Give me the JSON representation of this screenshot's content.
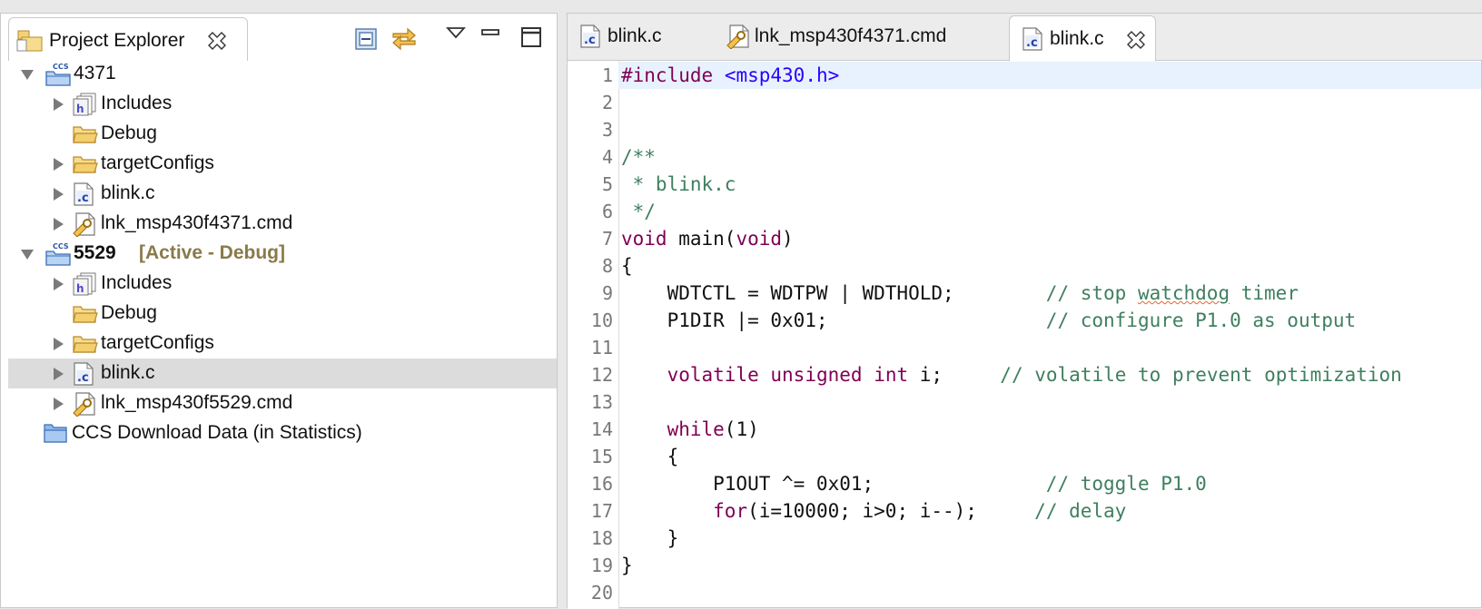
{
  "explorer": {
    "title": "Project Explorer",
    "tree": [
      {
        "label": "4371",
        "bold": false,
        "twisty": "open",
        "indent": 0,
        "icon": "ccs-project-icon"
      },
      {
        "label": "Includes",
        "twisty": "closed",
        "indent": 1,
        "icon": "includes-icon"
      },
      {
        "label": "Debug",
        "twisty": "none",
        "indent": 1,
        "icon": "folder-icon"
      },
      {
        "label": "targetConfigs",
        "twisty": "closed",
        "indent": 1,
        "icon": "folder-icon"
      },
      {
        "label": "blink.c",
        "twisty": "closed",
        "indent": 1,
        "icon": "c-file-icon"
      },
      {
        "label": "lnk_msp430f4371.cmd",
        "twisty": "closed",
        "indent": 1,
        "icon": "cmd-file-icon"
      },
      {
        "label": "5529",
        "bold": true,
        "decoration": "[Active - Debug]",
        "twisty": "open",
        "indent": 0,
        "icon": "ccs-project-icon"
      },
      {
        "label": "Includes",
        "twisty": "closed",
        "indent": 1,
        "icon": "includes-icon"
      },
      {
        "label": "Debug",
        "twisty": "none",
        "indent": 1,
        "icon": "folder-icon"
      },
      {
        "label": "targetConfigs",
        "twisty": "closed",
        "indent": 1,
        "icon": "folder-icon"
      },
      {
        "label": "blink.c",
        "twisty": "closed",
        "indent": 1,
        "icon": "c-file-icon",
        "selected": true
      },
      {
        "label": "lnk_msp430f5529.cmd",
        "twisty": "closed",
        "indent": 1,
        "icon": "cmd-file-icon"
      },
      {
        "label": "CCS Download Data (in Statistics)",
        "twisty": "none",
        "indent": 0,
        "icon": "blue-folder-icon"
      }
    ]
  },
  "editor": {
    "tabs": [
      {
        "label": "blink.c",
        "icon": "c-file-icon",
        "active": false
      },
      {
        "label": "lnk_msp430f4371.cmd",
        "icon": "cmd-file-icon",
        "active": false
      },
      {
        "label": "blink.c",
        "icon": "c-file-icon",
        "active": true,
        "closable": true
      }
    ],
    "lines": [
      {
        "n": "1",
        "current": true,
        "parts": [
          {
            "t": "#include",
            "c": "pp"
          },
          {
            "t": " "
          },
          {
            "t": "<msp430.h>",
            "c": "str"
          }
        ]
      },
      {
        "n": "2",
        "parts": []
      },
      {
        "n": "3",
        "parts": []
      },
      {
        "n": "4",
        "parts": [
          {
            "t": "/**",
            "c": "cm"
          }
        ]
      },
      {
        "n": "5",
        "parts": [
          {
            "t": " * blink.c",
            "c": "cm"
          }
        ]
      },
      {
        "n": "6",
        "parts": [
          {
            "t": " */",
            "c": "cm"
          }
        ]
      },
      {
        "n": "7",
        "parts": [
          {
            "t": "void",
            "c": "kw"
          },
          {
            "t": " main("
          },
          {
            "t": "void",
            "c": "kw"
          },
          {
            "t": ")"
          }
        ]
      },
      {
        "n": "8",
        "parts": [
          {
            "t": "{"
          }
        ]
      },
      {
        "n": "9",
        "parts": [
          {
            "t": "    WDTCTL = WDTPW | WDTHOLD;        "
          },
          {
            "t": "// stop ",
            "c": "cm"
          },
          {
            "t": "watchdog",
            "c": "cm sq"
          },
          {
            "t": " timer",
            "c": "cm"
          }
        ]
      },
      {
        "n": "10",
        "parts": [
          {
            "t": "    P1DIR |= 0x01;                   "
          },
          {
            "t": "// configure P1.0 as output",
            "c": "cm"
          }
        ]
      },
      {
        "n": "11",
        "parts": []
      },
      {
        "n": "12",
        "parts": [
          {
            "t": "    "
          },
          {
            "t": "volatile",
            "c": "kw"
          },
          {
            "t": " "
          },
          {
            "t": "unsigned",
            "c": "kw"
          },
          {
            "t": " "
          },
          {
            "t": "int",
            "c": "kw"
          },
          {
            "t": " i;     "
          },
          {
            "t": "// volatile to prevent optimization",
            "c": "cm"
          }
        ]
      },
      {
        "n": "13",
        "parts": []
      },
      {
        "n": "14",
        "parts": [
          {
            "t": "    "
          },
          {
            "t": "while",
            "c": "kw"
          },
          {
            "t": "(1)"
          }
        ]
      },
      {
        "n": "15",
        "parts": [
          {
            "t": "    {"
          }
        ]
      },
      {
        "n": "16",
        "parts": [
          {
            "t": "        P1OUT ^= 0x01;               "
          },
          {
            "t": "// toggle P1.0",
            "c": "cm"
          }
        ]
      },
      {
        "n": "17",
        "parts": [
          {
            "t": "        "
          },
          {
            "t": "for",
            "c": "kw"
          },
          {
            "t": "(i=10000; i>0; i--);     "
          },
          {
            "t": "// delay",
            "c": "cm"
          }
        ]
      },
      {
        "n": "18",
        "parts": [
          {
            "t": "    }"
          }
        ]
      },
      {
        "n": "19",
        "parts": [
          {
            "t": "}"
          }
        ]
      },
      {
        "n": "20",
        "parts": []
      }
    ]
  }
}
